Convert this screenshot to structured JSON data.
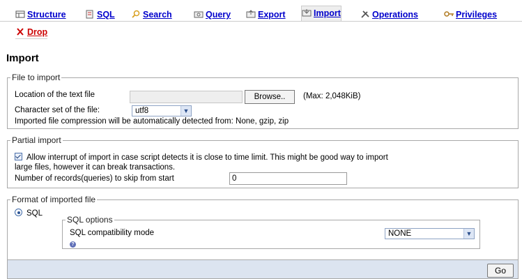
{
  "tabs": [
    {
      "label": "Structure",
      "icon": "table-structure-icon"
    },
    {
      "label": "SQL",
      "icon": "sql-icon"
    },
    {
      "label": "Search",
      "icon": "search-icon"
    },
    {
      "label": "Query",
      "icon": "query-icon"
    },
    {
      "label": "Export",
      "icon": "export-icon"
    },
    {
      "label": "Import",
      "icon": "import-icon"
    },
    {
      "label": "Operations",
      "icon": "operations-icon"
    },
    {
      "label": "Privileges",
      "icon": "privileges-icon"
    },
    {
      "label": "Drop",
      "icon": "drop-icon"
    }
  ],
  "page_title": "Import",
  "file_to_import": {
    "legend": "File to import",
    "location_label": "Location of the text file",
    "browse_label": "Browse..",
    "max_size": "(Max: 2,048KiB)",
    "charset_label": "Character set of the file:",
    "charset_value": "utf8",
    "compression_note": "Imported file compression will be automatically detected from: None, gzip, zip"
  },
  "partial_import": {
    "legend": "Partial import",
    "allow_interrupt_line1": "Allow interrupt of import in case script detects it is close to time limit. This might be good way to import",
    "allow_interrupt_line2": "large files, however it can break transactions.",
    "skip_label": "Number of records(queries) to skip from start",
    "skip_value": "0"
  },
  "format": {
    "legend": "Format of imported file",
    "option_sql": "SQL",
    "sql_options_legend": "SQL options",
    "compat_label": "SQL compatibility mode",
    "compat_value": "NONE"
  },
  "go_label": "Go",
  "colors": {
    "tab_link": "#0000cc",
    "drop_link": "#cc0000",
    "footer_bg": "#dce4f0"
  }
}
